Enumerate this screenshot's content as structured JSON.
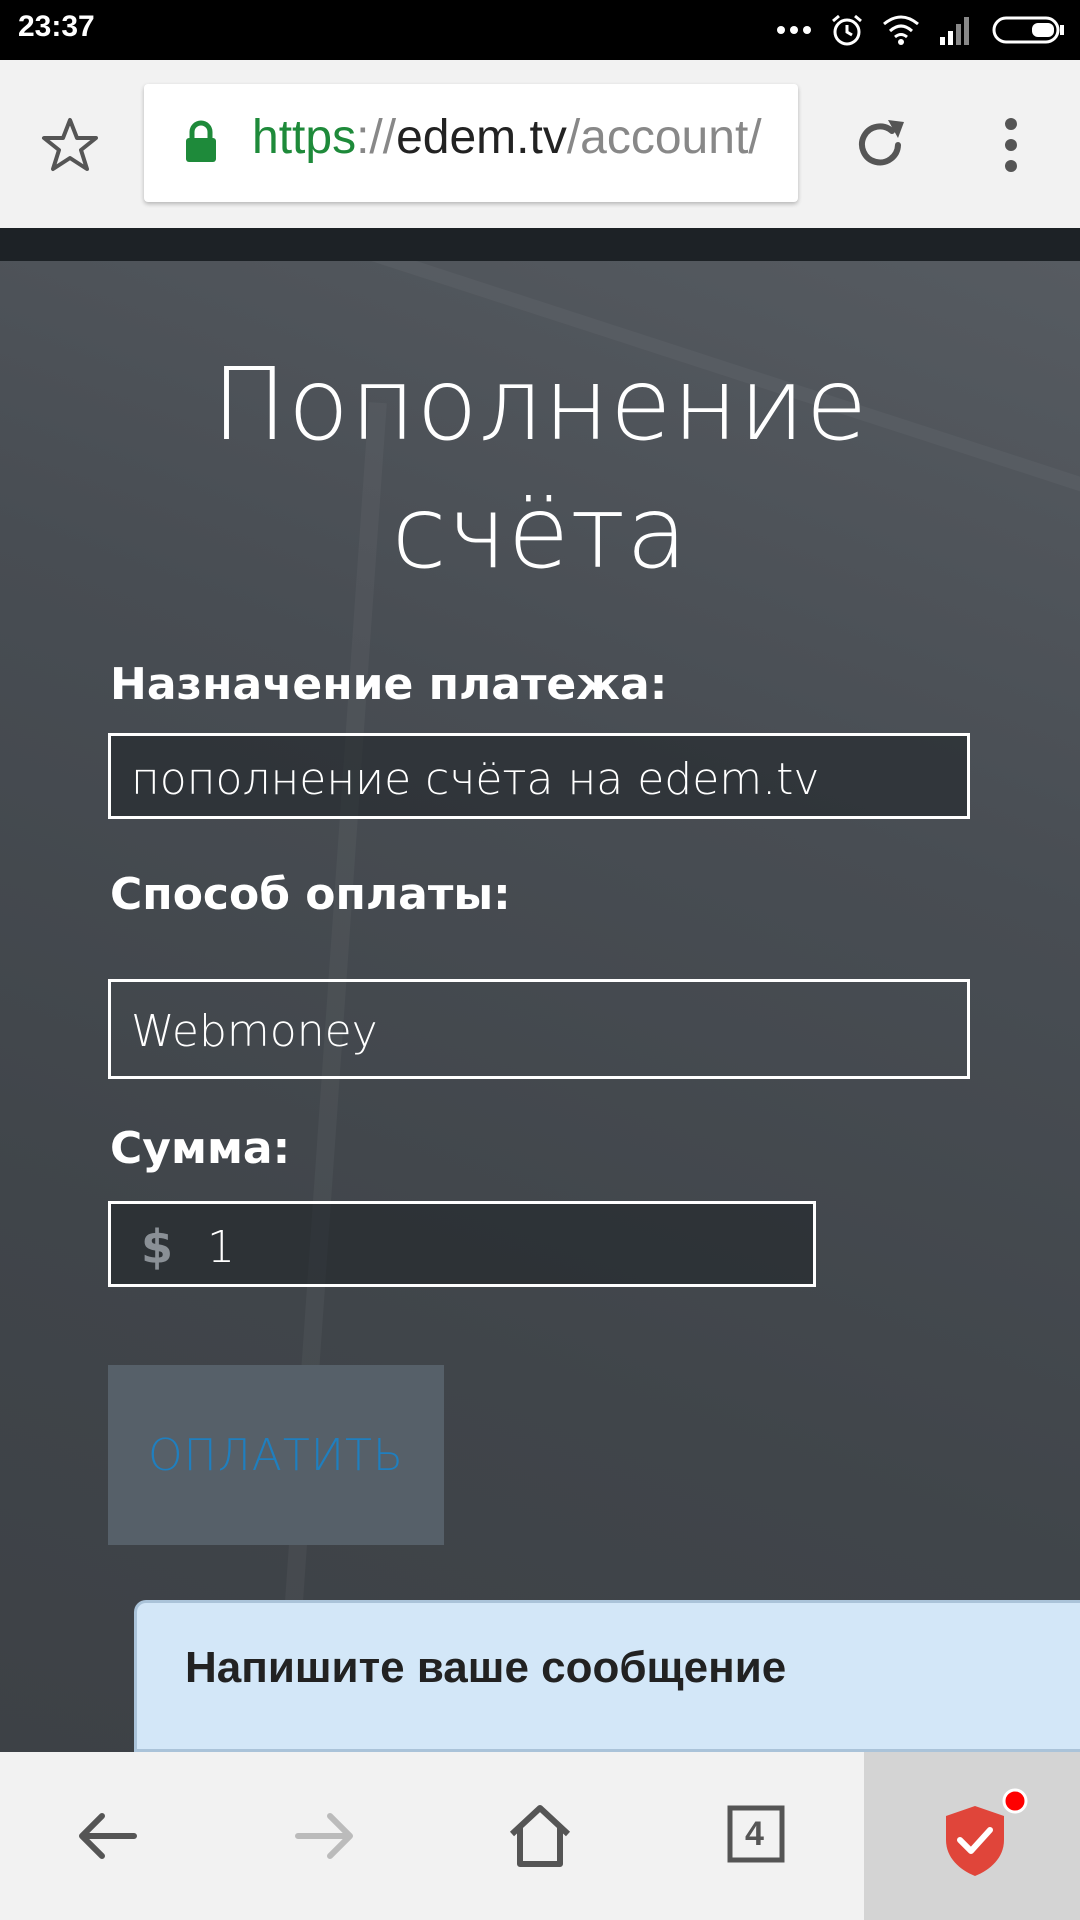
{
  "status_bar": {
    "time": "23:37",
    "icons": [
      "more-dots-icon",
      "alarm-icon",
      "wifi-icon",
      "signal-icon",
      "battery-icon"
    ]
  },
  "browser": {
    "url_scheme": "https",
    "url_separator": "://",
    "url_host": "edem.tv",
    "url_path": "/account/",
    "tab_count": "4"
  },
  "page": {
    "title_line1": "Пополнение",
    "title_line2": "счёта",
    "purpose_label": "Назначение платежа:",
    "purpose_value": "пополнение счёта на edem.tv",
    "method_label": "Способ оплаты:",
    "method_value": "Webmoney",
    "amount_label": "Сумма:",
    "currency_symbol": "$",
    "amount_value": "1",
    "pay_button": "ОПЛАТИТЬ",
    "chat_placeholder": "Напишите ваше сообщение"
  },
  "colors": {
    "url_secure": "#1e8a3a",
    "pay_text": "#1f7fbf",
    "shield": "#e0453a",
    "notification_dot": "#ff0000"
  }
}
